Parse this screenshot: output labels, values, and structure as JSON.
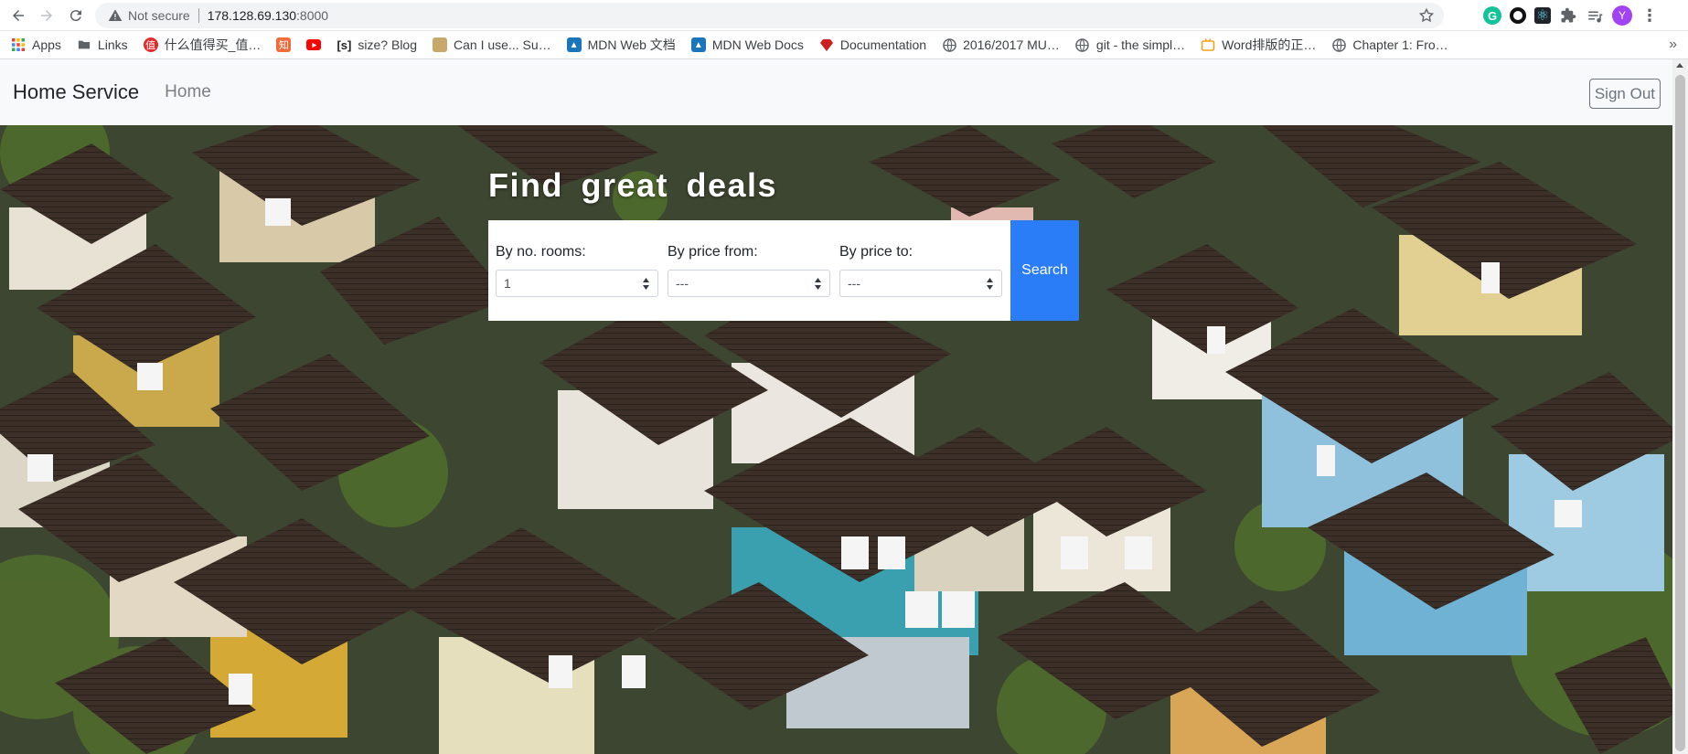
{
  "browser": {
    "not_secure": "Not secure",
    "url_host": "178.128.69.130",
    "url_port": ":8000",
    "profile_initial": "Y"
  },
  "bookmarks": [
    {
      "label": "Apps",
      "icon": "apps-grid-icon",
      "color": "#e8453c"
    },
    {
      "label": "Links",
      "icon": "folder-icon",
      "color": "#5f6368"
    },
    {
      "label": "什么值得买_值…",
      "icon": "smzdm-icon",
      "color": "#e62828"
    },
    {
      "label": "",
      "icon": "orange-site-icon",
      "color": "#f26b3a"
    },
    {
      "label": "",
      "icon": "youtube-icon",
      "color": "#ff0000"
    },
    {
      "label": "size? Blog",
      "icon": "size-blog-icon",
      "color": "#222222"
    },
    {
      "label": "Can I use... Su…",
      "icon": "caniuse-icon",
      "color": "#9c5b2d"
    },
    {
      "label": "MDN Web 文档",
      "icon": "mdn-icon",
      "color": "#1b75bb"
    },
    {
      "label": "MDN Web Docs",
      "icon": "mdn-icon",
      "color": "#1b75bb"
    },
    {
      "label": "Documentation",
      "icon": "ruby-icon",
      "color": "#cc1f1f"
    },
    {
      "label": "2016/2017 MU…",
      "icon": "globe-icon",
      "color": "#5f6368"
    },
    {
      "label": "git - the simpl…",
      "icon": "globe-icon",
      "color": "#5f6368"
    },
    {
      "label": "Word排版的正…",
      "icon": "bilibili-icon",
      "color": "#f4a21c"
    },
    {
      "label": "Chapter 1: Fro…",
      "icon": "globe-icon",
      "color": "#5f6368"
    }
  ],
  "navbar": {
    "brand": "Home Service",
    "home_link": "Home",
    "sign_out": "Sign Out"
  },
  "hero": {
    "title": "Find  great  deals",
    "rooms_label": "By no. rooms:",
    "rooms_value": "1",
    "price_from_label": "By price from:",
    "price_from_value": "---",
    "price_to_label": "By price to:",
    "price_to_value": "---",
    "search_label": "Search"
  },
  "colors": {
    "search_button": "#2b7cf7",
    "navbar_bg": "#f8f9fa"
  }
}
